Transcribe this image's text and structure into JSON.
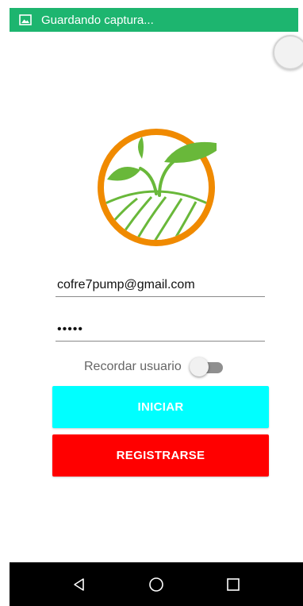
{
  "status_bar": {
    "icon": "image-icon",
    "text": "Guardando captura..."
  },
  "login": {
    "logo_icon": "sprout-logo-icon",
    "email_value": "cofre7pump@gmail.com",
    "password_value": "•••••",
    "remember_label": "Recordar usuario",
    "remember_enabled": false,
    "login_button": "INICIAR",
    "register_button": "REGISTRARSE"
  },
  "nav": {
    "back_icon": "back-triangle-icon",
    "home_icon": "home-circle-icon",
    "recents_icon": "recents-square-icon"
  },
  "colors": {
    "status_bar": "#1db56f",
    "login_button": "#00ffff",
    "register_button": "#ff0000",
    "logo_ring": "#f08a00",
    "logo_leaf": "#69b83a"
  }
}
